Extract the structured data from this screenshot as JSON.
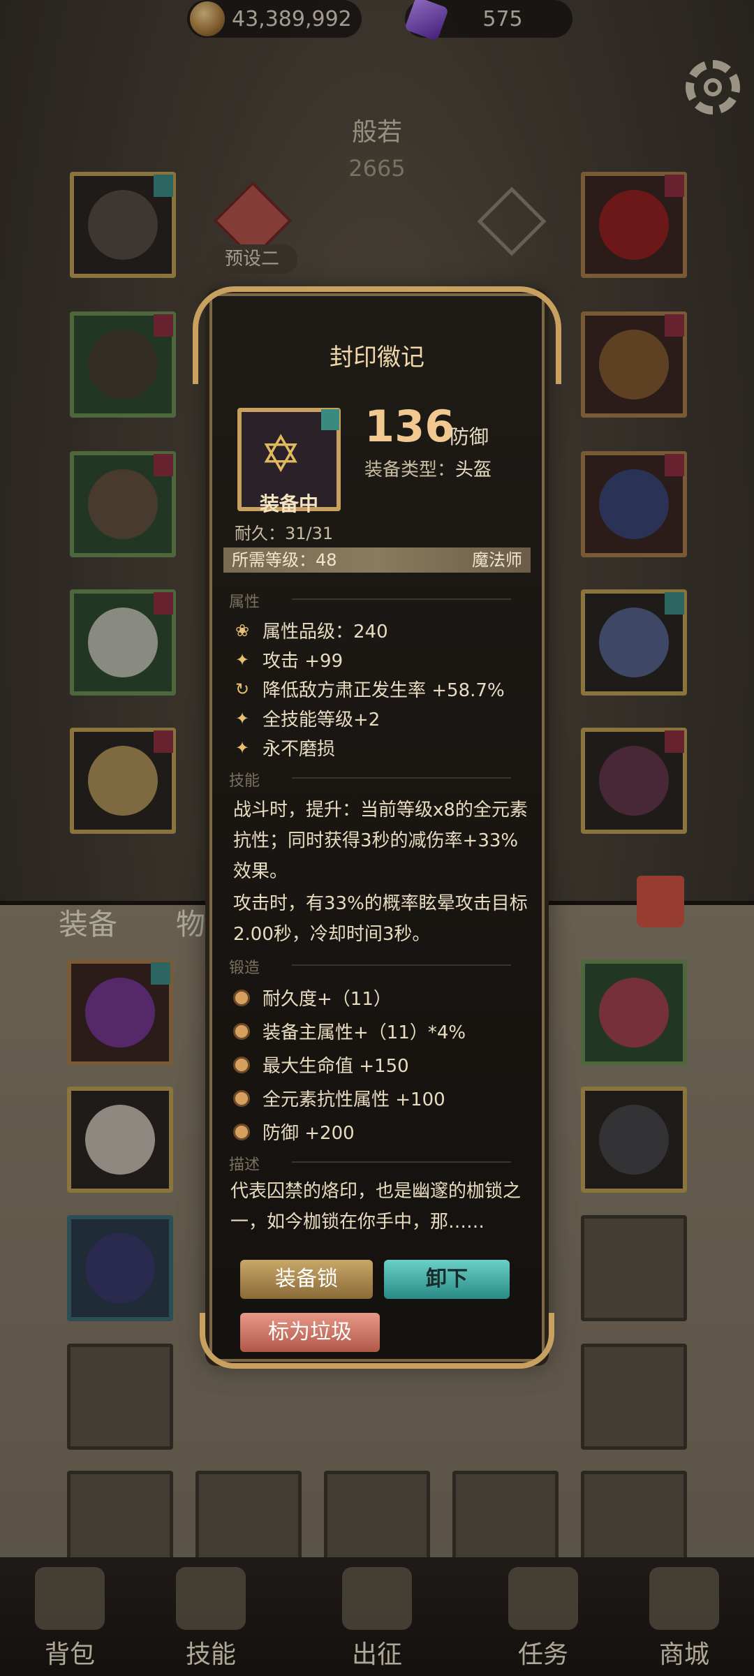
{
  "currency": {
    "gold": "43,389,992",
    "gems": "575"
  },
  "character": {
    "name": "般若",
    "score": "2665",
    "preset": "预设二"
  },
  "tabs": {
    "equip": "装备",
    "items": "物品"
  },
  "nav": [
    "背包",
    "技能",
    "出征",
    "任务",
    "商城"
  ],
  "popup": {
    "title": "封印徽记",
    "equipped_label": "装备中",
    "value": "136",
    "value_unit": "防御",
    "type_label": "装备类型：",
    "type_value": "头盔",
    "durability": "耐久：31/31",
    "req_level": "所需等级：48",
    "req_class": "魔法师",
    "sections": {
      "attr": "属性",
      "skill": "技能",
      "forge": "锻造",
      "desc": "描述"
    },
    "attributes": [
      "属性品级：240",
      "攻击 +99",
      "降低敌方肃正发生率 +58.7%",
      "全技能等级+2",
      "永不磨损"
    ],
    "skill_text_1": "战斗时，提升：当前等级x8的全元素抗性；同时获得3秒的减伤率+33%效果。",
    "skill_text_2": "攻击时，有33%的概率眩晕攻击目标2.00秒，冷却时间3秒。",
    "forge": [
      "耐久度+（11）",
      "装备主属性+（11）*4%",
      "最大生命值 +150",
      "全元素抗性属性 +100",
      "防御 +200"
    ],
    "description": "代表囚禁的烙印，也是幽邃的枷锁之一，如今枷锁在你手中，那……",
    "buttons": {
      "lock": "装备锁",
      "unequip": "卸下",
      "trash": "标为垃圾"
    }
  }
}
